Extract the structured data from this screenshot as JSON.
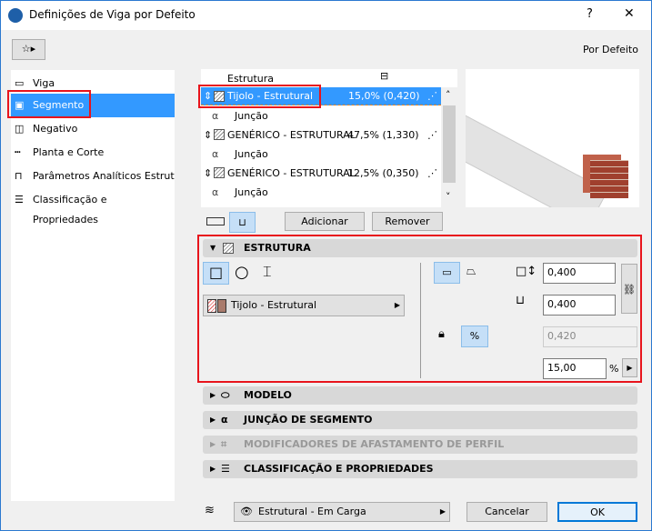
{
  "window": {
    "title": "Definições de Viga por Defeito",
    "help": "?",
    "close": "✕",
    "preset": "Por Defeito"
  },
  "sidebar": {
    "items": [
      {
        "label": "Viga",
        "icon": "beam-icon"
      },
      {
        "label": "Segmento",
        "icon": "segment-icon"
      },
      {
        "label": "Negativo",
        "icon": "hole-icon"
      },
      {
        "label": "Planta e Corte",
        "icon": "plan-section-icon"
      },
      {
        "label": "Parâmetros Analíticos Estrut...",
        "icon": "analytic-icon"
      },
      {
        "label": "Classificação e Propriedades",
        "icon": "classification-icon"
      }
    ],
    "selected": 1
  },
  "segments": {
    "header": "Estrutura",
    "rows": [
      {
        "type": "segment",
        "name": "Tijolo - Estrutural",
        "value": "15,0% (0,420)",
        "selected": true
      },
      {
        "type": "joint",
        "name": "Junção"
      },
      {
        "type": "segment",
        "name": "GENÉRICO - ESTRUTURAL",
        "value": "47,5% (1,330)"
      },
      {
        "type": "joint",
        "name": "Junção"
      },
      {
        "type": "segment",
        "name": "GENÉRICO - ESTRUTURAL",
        "value": "12,5% (0,350)"
      },
      {
        "type": "joint",
        "name": "Junção"
      }
    ],
    "add": "Adicionar",
    "remove": "Remover"
  },
  "estrutura": {
    "title": "ESTRUTURA",
    "material": "Tijolo - Estrutural",
    "width": "0,400",
    "height": "0,400",
    "length": "0,420",
    "percent": "15,00",
    "percent_unit": "%",
    "brick_color": "#a97b6c"
  },
  "panels": [
    {
      "title": "MODELO",
      "enabled": true
    },
    {
      "title": "JUNÇÃO DE SEGMENTO",
      "enabled": true
    },
    {
      "title": "MODIFICADORES DE AFASTAMENTO DE PERFIL",
      "enabled": false
    },
    {
      "title": "CLASSIFICAÇÃO E PROPRIEDADES",
      "enabled": true
    }
  ],
  "footer": {
    "layer": "Estrutural - Em Carga",
    "cancel": "Cancelar",
    "ok": "OK"
  }
}
